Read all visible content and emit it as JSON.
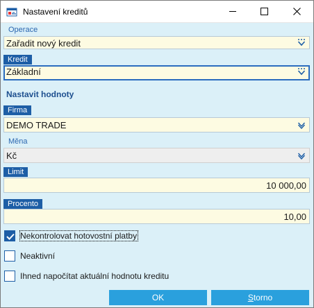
{
  "window": {
    "title": "Nastavení kreditů"
  },
  "operace": {
    "label": "Operace",
    "value": "Zařadit nový kredit"
  },
  "kredit": {
    "label": "Kredit",
    "value": "Základní"
  },
  "section": {
    "title": "Nastavit hodnoty"
  },
  "firma": {
    "label": "Firma",
    "value": "DEMO TRADE"
  },
  "mena": {
    "label": "Měna",
    "value": "Kč"
  },
  "limit": {
    "label": "Limit",
    "value": "10 000,00"
  },
  "procento": {
    "label": "Procento",
    "value": "10,00"
  },
  "checkboxes": [
    {
      "label": "Nekontrolovat hotovostní platby",
      "checked": true
    },
    {
      "label": "Neaktivní",
      "checked": false
    },
    {
      "label": "Ihned napočítat aktuální hodnotu kreditu",
      "checked": false
    }
  ],
  "buttons": {
    "ok": {
      "label": "OK"
    },
    "storno": {
      "first": "S",
      "rest": "torno"
    }
  },
  "colors": {
    "accent": "#1d5ea6",
    "background": "#dbf0f8",
    "field": "#fdfbe2",
    "button": "#2aa0dd"
  }
}
